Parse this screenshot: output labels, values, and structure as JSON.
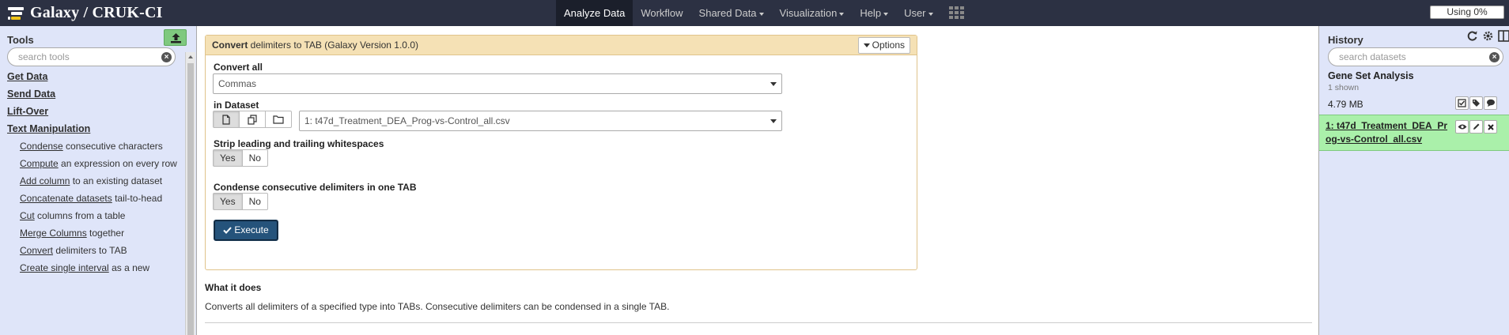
{
  "masthead": {
    "brand": "Galaxy / CRUK-CI",
    "nav": [
      {
        "label": "Analyze Data",
        "active": true,
        "dropdown": false
      },
      {
        "label": "Workflow",
        "active": false,
        "dropdown": false
      },
      {
        "label": "Shared Data",
        "active": false,
        "dropdown": true
      },
      {
        "label": "Visualization",
        "active": false,
        "dropdown": true
      },
      {
        "label": "Help",
        "active": false,
        "dropdown": true
      },
      {
        "label": "User",
        "active": false,
        "dropdown": true
      }
    ],
    "quota": "Using 0%"
  },
  "tools_panel": {
    "title": "Tools",
    "search_placeholder": "search tools",
    "sections": [
      "Get Data",
      "Send Data",
      "Lift-Over",
      "Text Manipulation"
    ],
    "tools": [
      {
        "link": "Condense",
        "desc": " consecutive characters"
      },
      {
        "link": "Compute",
        "desc": " an expression on every row"
      },
      {
        "link": "Add column",
        "desc": " to an existing dataset"
      },
      {
        "link": "Concatenate datasets",
        "desc": " tail-to-head"
      },
      {
        "link": "Cut",
        "desc": " columns from a table"
      },
      {
        "link": "Merge Columns",
        "desc": " together"
      },
      {
        "link": "Convert",
        "desc": " delimiters to TAB"
      },
      {
        "link": "Create single interval",
        "desc": " as a new"
      }
    ]
  },
  "tool_form": {
    "title_bold": "Convert",
    "title_rest": " delimiters to TAB (Galaxy Version 1.0.0)",
    "options_label": "Options",
    "convert_all": {
      "label": "Convert all",
      "value": "Commas"
    },
    "in_dataset": {
      "label": "in Dataset",
      "value": "1: t47d_Treatment_DEA_Prog-vs-Control_all.csv"
    },
    "strip": {
      "label": "Strip leading and trailing whitespaces",
      "yes": "Yes",
      "no": "No",
      "selected": "Yes"
    },
    "condense": {
      "label": "Condense consecutive delimiters in one TAB",
      "yes": "Yes",
      "no": "No",
      "selected": "Yes"
    },
    "execute_label": "Execute"
  },
  "help": {
    "title": "What it does",
    "text": "Converts all delimiters of a specified type into TABs. Consecutive delimiters can be condensed in a single TAB."
  },
  "history": {
    "title": "History",
    "search_placeholder": "search datasets",
    "name": "Gene Set Analysis",
    "shown": "1 shown",
    "size": "4.79 MB",
    "datasets": [
      {
        "title": "1: t47d_Treatment_DEA_Prog-vs-Control_all.csv",
        "state_color": "#aaf0aa"
      }
    ]
  }
}
